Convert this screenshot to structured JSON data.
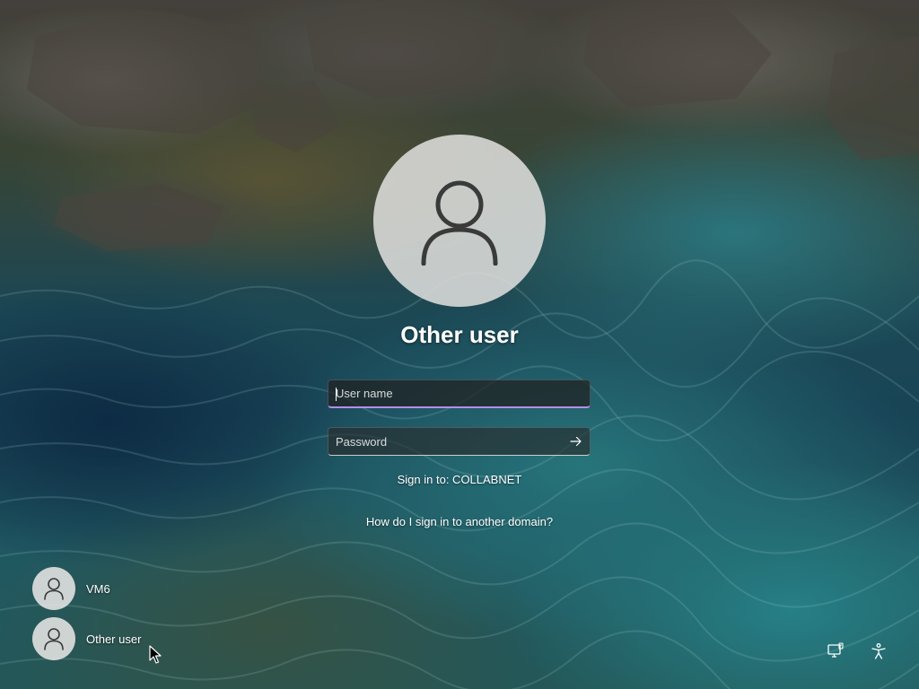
{
  "current_user": {
    "name": "Other user",
    "avatar_icon": "person-icon"
  },
  "username_field": {
    "value": "",
    "placeholder": "User name",
    "focus_color": "#b48ee8"
  },
  "password_field": {
    "value": "",
    "placeholder": "Password",
    "submit_icon": "arrow-right-icon"
  },
  "sign_in_to": "Sign in to: COLLABNET",
  "help_link": "How do I sign in to another domain?",
  "user_list": [
    {
      "name": "VM6",
      "icon": "person-icon"
    },
    {
      "name": "Other user",
      "icon": "person-icon"
    }
  ],
  "system_buttons": {
    "network_icon": "network-icon",
    "accessibility_icon": "accessibility-icon"
  }
}
